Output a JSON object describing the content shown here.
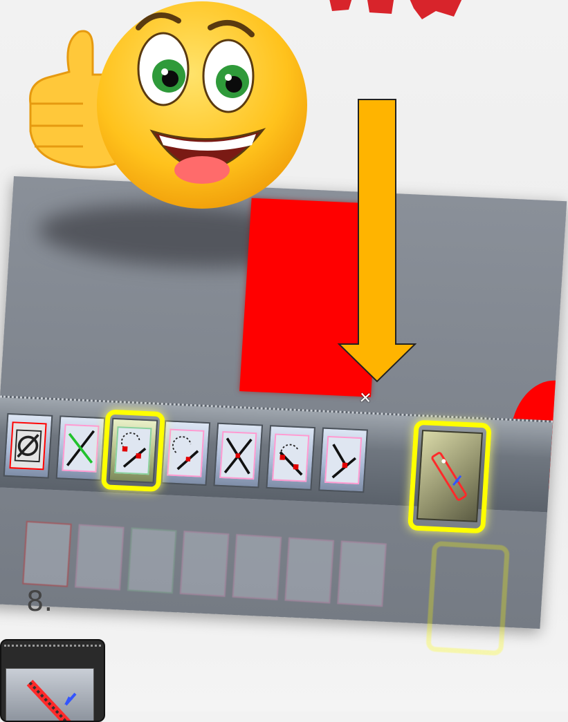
{
  "step": {
    "number": "8."
  },
  "toolbar": {
    "buttons": [
      {
        "icon": "circle-slash-icon"
      },
      {
        "icon": "line-cross-icon"
      },
      {
        "icon": "arc-snap-icon",
        "highlighted": true
      },
      {
        "icon": "arc-line-icon"
      },
      {
        "icon": "x-cross-icon"
      },
      {
        "icon": "arc-segment-icon"
      },
      {
        "icon": "line-endpoint-icon"
      }
    ],
    "extra_button": {
      "icon": "measure-pencil-icon",
      "highlighted": true
    }
  },
  "colors": {
    "highlight": "#ffff00",
    "arrow": "#ffb400",
    "shape": "#ff0000",
    "background": "#7e848d"
  }
}
